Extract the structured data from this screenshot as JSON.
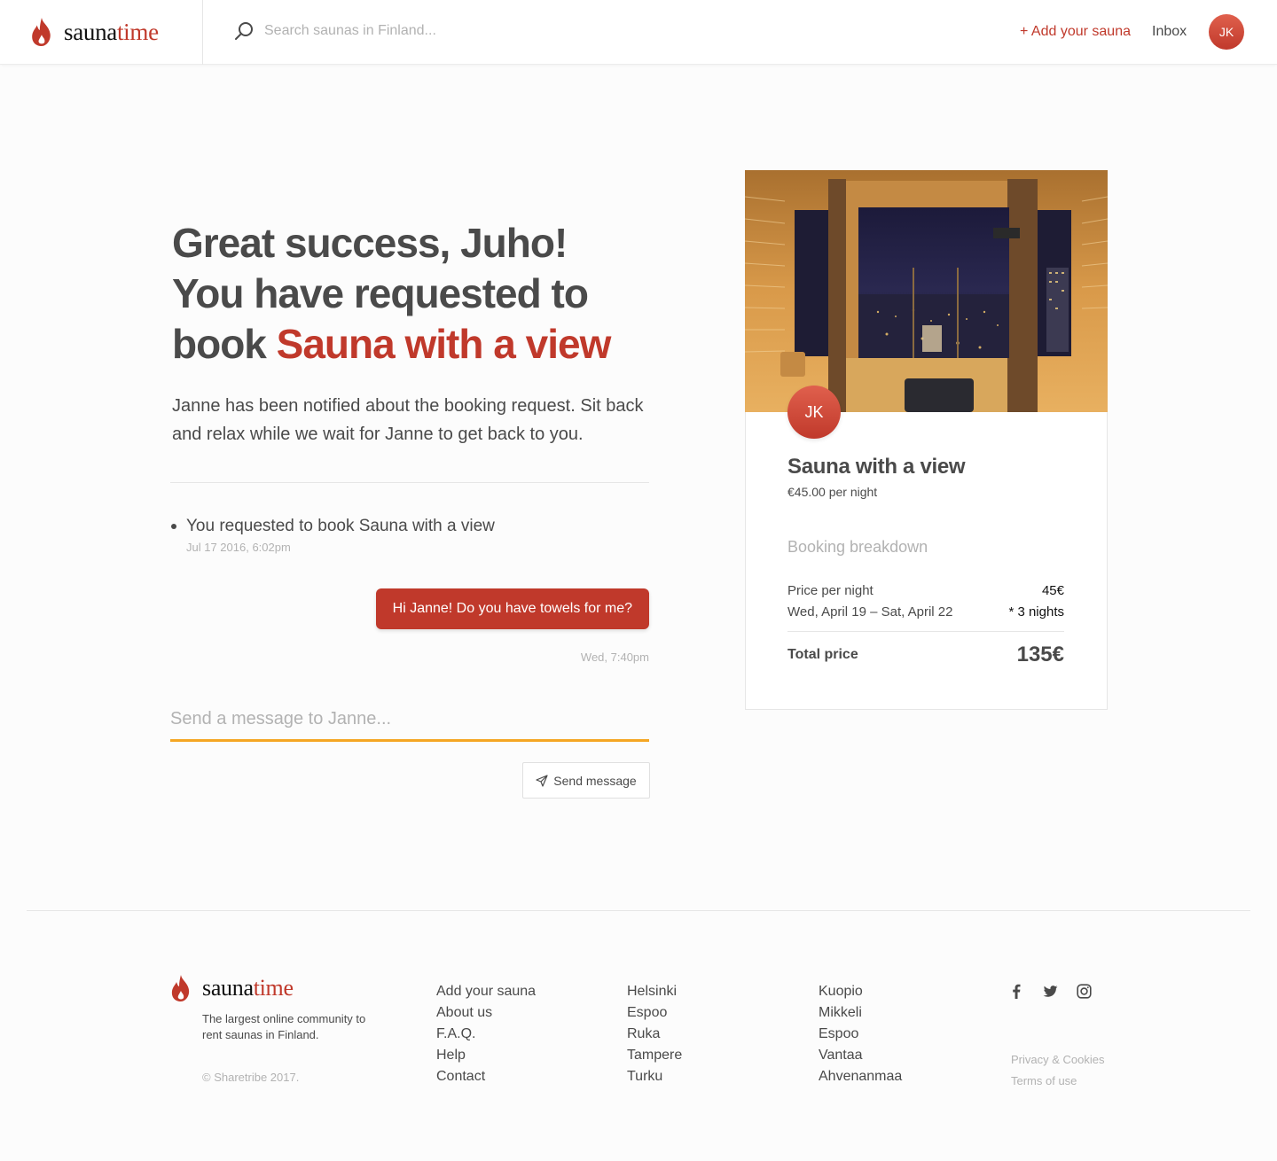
{
  "brand": {
    "name_dark": "sauna",
    "name_red": "time",
    "accent": "#c0392b",
    "input_underline": "#f5a623"
  },
  "topbar": {
    "search_placeholder": "Search saunas in Finland...",
    "add_link": "+ Add your sauna",
    "inbox_link": "Inbox",
    "avatar_initials": "JK"
  },
  "main": {
    "headline_line1": "Great success, Juho!",
    "headline_line2": "You have requested to",
    "headline_line3_prefix": "book ",
    "headline_listing": "Sauna with a view",
    "lead": "Janne has been notified about the booking request. Sit back and relax while we wait for Janne to get back to you.",
    "event": {
      "text": "You requested to book Sauna with a view",
      "time": "Jul 17 2016, 6:02pm"
    },
    "message": {
      "text": "Hi Janne! Do you have towels for me?",
      "time": "Wed, 7:40pm"
    },
    "message_input_placeholder": "Send a message to Janne...",
    "send_button": "Send message"
  },
  "card": {
    "avatar_initials": "JK",
    "title": "Sauna with a view",
    "price": "€45.00 per night",
    "breakdown_title": "Booking breakdown",
    "rows": [
      {
        "label": "Price per night",
        "value": "45€"
      },
      {
        "label": "Wed, April 19 – Sat, April 22",
        "value": "* 3 nights"
      }
    ],
    "total_label": "Total price",
    "total_value": "135€"
  },
  "footer": {
    "tagline": "The largest online community to rent saunas in Finland.",
    "copyright": "© Sharetribe 2017.",
    "col1": [
      "Add your sauna",
      "About us",
      "F.A.Q.",
      "Help",
      "Contact"
    ],
    "col2": [
      "Helsinki",
      "Espoo",
      "Ruka",
      "Tampere",
      "Turku"
    ],
    "col3": [
      "Kuopio",
      "Mikkeli",
      "Espoo",
      "Vantaa",
      "Ahvenanmaa"
    ],
    "social": [
      "facebook-icon",
      "twitter-icon",
      "instagram-icon"
    ],
    "legal": [
      "Privacy & Cookies",
      "Terms of use"
    ]
  }
}
